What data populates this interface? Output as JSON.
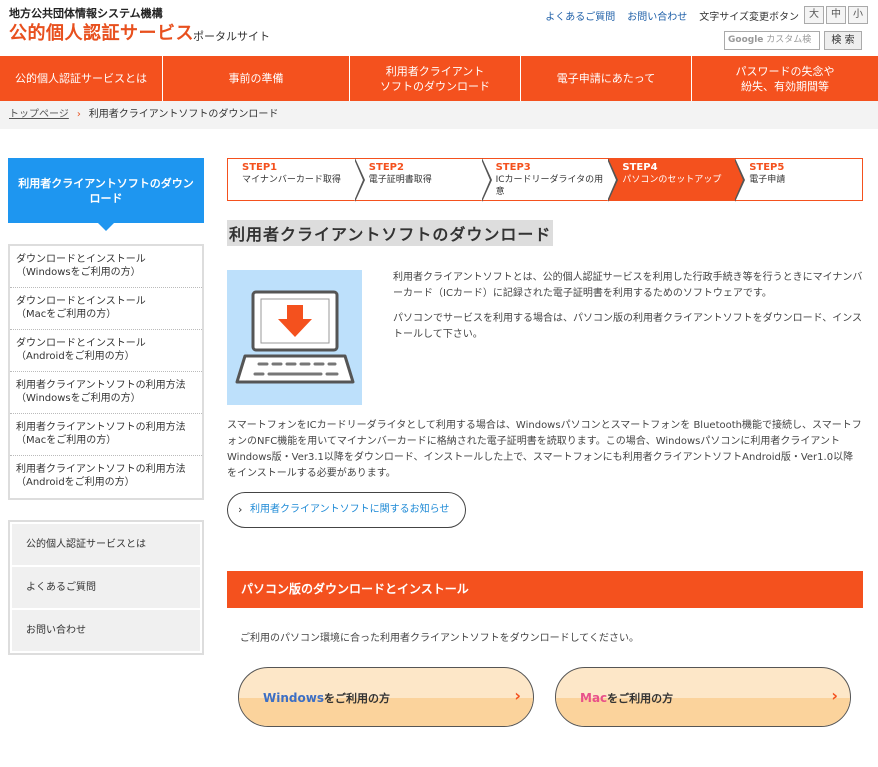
{
  "header": {
    "org": "地方公共団体情報システム機構",
    "site_title": "公的個人認証サービス",
    "portal": "ポータルサイト",
    "links": [
      "よくあるご質問",
      "お問い合わせ"
    ],
    "font_size_label": "文字サイズ変更ボタン",
    "font_sizes": [
      "大",
      "中",
      "小"
    ],
    "search_placeholder": "カスタム検",
    "search_brand": "Google",
    "search_button": "検 索"
  },
  "nav": {
    "items": [
      "公的個人認証サービスとは",
      "事前の準備",
      "利用者クライアント\nソフトのダウンロード",
      "電子申請にあたって",
      "パスワードの失念や\n紛失、有効期間等"
    ]
  },
  "breadcrumb": {
    "home": "トップページ",
    "sep": "›",
    "current": "利用者クライアントソフトのダウンロード"
  },
  "sidebar": {
    "heading": "利用者クライアントソフトのダウンロード",
    "items": [
      "ダウンロードとインストール\n（Windowsをご利用の方）",
      "ダウンロードとインストール\n（Macをご利用の方）",
      "ダウンロードとインストール\n（Androidをご利用の方）",
      "利用者クライアントソフトの利用方法（Windowsをご利用の方）",
      "利用者クライアントソフトの利用方法（Macをご利用の方）",
      "利用者クライアントソフトの利用方法（Androidをご利用の方）"
    ],
    "links": [
      "公的個人認証サービスとは",
      "よくあるご質問",
      "お問い合わせ"
    ]
  },
  "steps": [
    {
      "num": "STEP1",
      "label": "マイナンバーカード取得",
      "active": false
    },
    {
      "num": "STEP2",
      "label": "電子証明書取得",
      "active": false
    },
    {
      "num": "STEP3",
      "label": "ICカードリーダライタの用意",
      "active": false
    },
    {
      "num": "STEP4",
      "label": "パソコンのセットアップ",
      "active": true
    },
    {
      "num": "STEP5",
      "label": "電子申請",
      "active": false
    }
  ],
  "main": {
    "title": "利用者クライアントソフトのダウンロード",
    "intro1": "利用者クライアントソフトとは、公的個人認証サービスを利用した行政手続き等を行うときにマイナンバーカード（ICカード）に記録された電子証明書を利用するためのソフトウェアです。",
    "intro2": "パソコンでサービスを利用する場合は、パソコン版の利用者クライアントソフトをダウンロード、インストールして下さい。",
    "para2": "スマートフォンをICカードリーダライタとして利用する場合は、Windowsパソコンとスマートフォンを Bluetooth機能で接続し、スマートフォンのNFC機能を用いてマイナンバーカードに格納された電子証明書を読取ります。この場合、Windowsパソコンに利用者クライアントWindows版・Ver3.1以降をダウンロード、インストールした上で、スマートフォンにも利用者クライアントソフトAndroid版・Ver1.0以降をインストールする必要があります。",
    "notice": "利用者クライアントソフトに関するお知らせ",
    "section_title": "パソコン版のダウンロードとインストール",
    "section_lead": "ご利用のパソコン環境に合った利用者クライアントソフトをダウンロードしてください。",
    "win_os": "Windows",
    "win_suffix": "をご利用の方",
    "mac_os": "Mac",
    "mac_suffix": "をご利用の方"
  },
  "colors": {
    "accent": "#f4511e",
    "sidebar_head": "#1e96f0",
    "illustration_bg": "#bde0fb"
  }
}
